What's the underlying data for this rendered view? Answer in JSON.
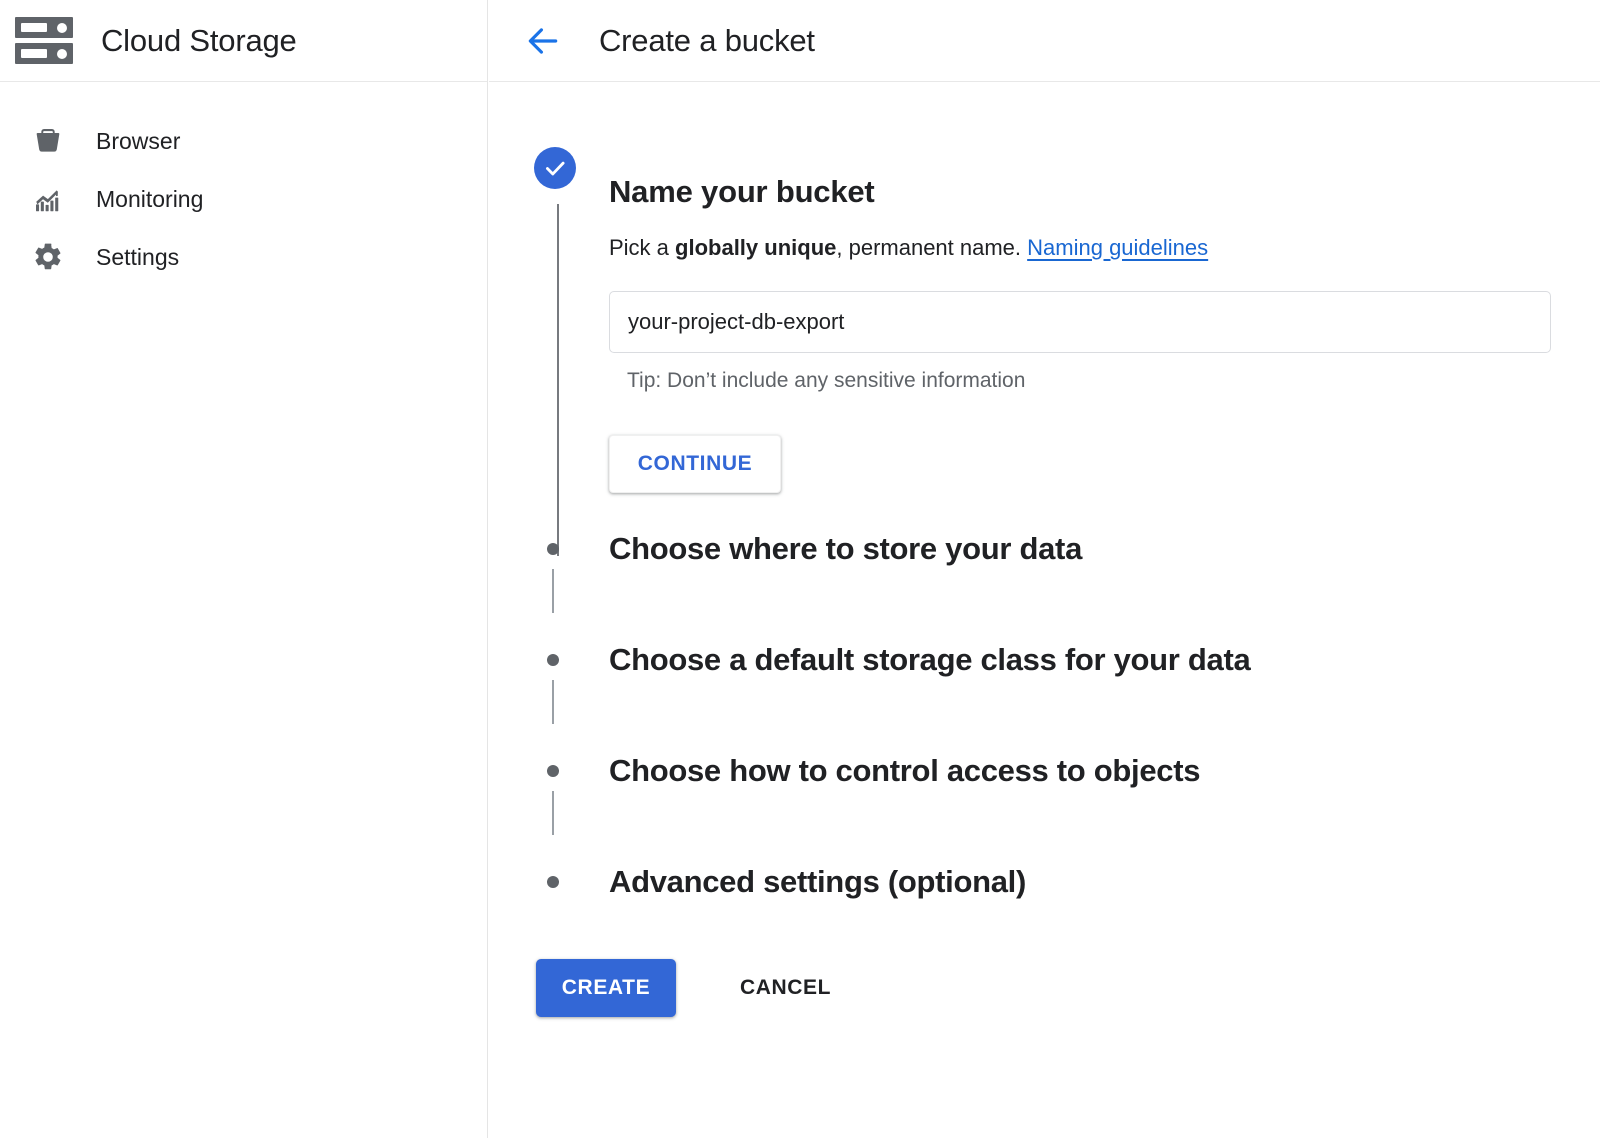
{
  "sidebar": {
    "app_title": "Cloud Storage",
    "logo_icon": "server-rack-icon",
    "items": [
      {
        "label": "Browser",
        "icon": "bucket-icon"
      },
      {
        "label": "Monitoring",
        "icon": "chart-icon"
      },
      {
        "label": "Settings",
        "icon": "gear-icon"
      }
    ]
  },
  "header": {
    "back_icon": "arrow-left-icon",
    "title": "Create a bucket"
  },
  "colors": {
    "accent_blue": "#3367d6",
    "link_blue": "#1967d2",
    "icon_grey": "#5f6368",
    "text_primary": "#202124"
  },
  "stepper": {
    "active_step": {
      "status_icon": "check-circle-icon",
      "title": "Name your bucket",
      "desc_prefix": "Pick a ",
      "desc_bold": "globally unique",
      "desc_suffix": ", permanent name. ",
      "desc_link": "Naming guidelines",
      "input": {
        "value": "your-project-db-export",
        "placeholder": ""
      },
      "tip": "Tip: Don’t include any sensitive information",
      "continue_label": "CONTINUE"
    },
    "collapsed_steps": [
      {
        "title": "Choose where to store your data"
      },
      {
        "title": "Choose a default storage class for your data"
      },
      {
        "title": "Choose how to control access to objects"
      },
      {
        "title": "Advanced settings (optional)"
      }
    ]
  },
  "actions": {
    "create_label": "CREATE",
    "cancel_label": "CANCEL"
  }
}
